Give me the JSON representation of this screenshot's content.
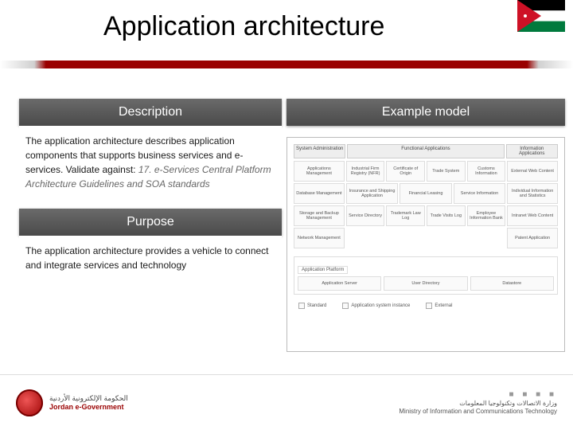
{
  "title": "Application architecture",
  "left": {
    "description": {
      "header": "Description",
      "body": "The application architecture describes application components that supports business services and e-services. Validate against:",
      "note": "17. e-Services Central Platform Architecture Guidelines and SOA standards"
    },
    "purpose": {
      "header": "Purpose",
      "body": "The application architecture provides a vehicle to connect and integrate services and technology"
    }
  },
  "right": {
    "header": "Example model",
    "colHeaders": [
      "System Administration",
      "Functional Applications",
      "Information Applications"
    ],
    "cols": {
      "c1": [
        "Applications Management",
        "Database Management",
        "Storage and Backup Management",
        "Network Management"
      ],
      "c2a": [
        "Industrial Firm Registry (NFR)",
        "Certificate of Origin",
        "Trade System",
        "Customs Information"
      ],
      "c2b": [
        "Insurance and Shipping Application",
        "Financial Leasing",
        "Service Information"
      ],
      "c2c": [
        "Service Directory",
        "Trademark Law Log",
        "Trade Visits Log",
        "Employee Information Bank"
      ],
      "c3": [
        "External Web Content",
        "Individual Information and Statistics",
        "Intranet Web Content",
        "Patent Application"
      ]
    },
    "platformHeader": "Application Platform",
    "platform": [
      "Application Server",
      "User Directory",
      "Datastore"
    ],
    "legend": [
      "Standard",
      "Application system instance",
      "External"
    ]
  },
  "footer": {
    "leftAr": "الحكومة الإلكترونية الأردنية",
    "leftEn": "Jordan e-Government",
    "rightAr": "وزارة الاتصالات وتكنولوجيا المعلومات",
    "rightEn": "Ministry of Information and Communications Technology"
  }
}
